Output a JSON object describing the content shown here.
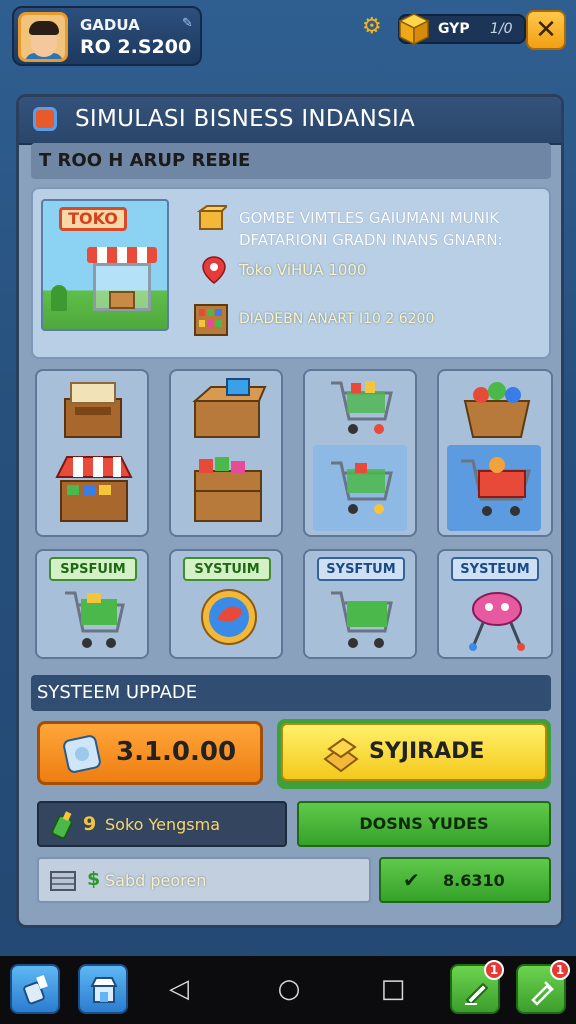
{
  "player": {
    "name": "GADUA",
    "money": "RO 2.S200"
  },
  "resources": {
    "label": "GYP",
    "value": "1/0"
  },
  "panel": {
    "title": "SIMULASI BISNESS INDANSIA",
    "subtitle": "T ROO H ARUP REBIE",
    "store_sign": "TOKO",
    "info_lines": [
      "GOMBE VIMTLES GAIUMANI MUNIK DFATARIONI GRADN INANS GNARN:",
      "Toko ViHUA 1000",
      "DIADEBN ANART I10 2 6200"
    ]
  },
  "system_tags": [
    "SPSFUIM",
    "SYSTUIM",
    "SYSFTUM",
    "SYSTEUM"
  ],
  "upgrade": {
    "heading": "SYSTEEM UPPADE",
    "cost_button": "3.1.0.00",
    "upgrade_button": "SYJIRADE",
    "store_label": "Soko Yengsma",
    "store_prefix": "9",
    "green_button": "DOSNS YUDES",
    "saved_label": "Sabd peoren",
    "confirm_value": "8.6310"
  },
  "nav": {
    "badge_left": "1",
    "badge_right": "1"
  },
  "colors": {
    "accent": "#f19f12",
    "green": "#37a22a",
    "panel": "#8aa1bd"
  }
}
